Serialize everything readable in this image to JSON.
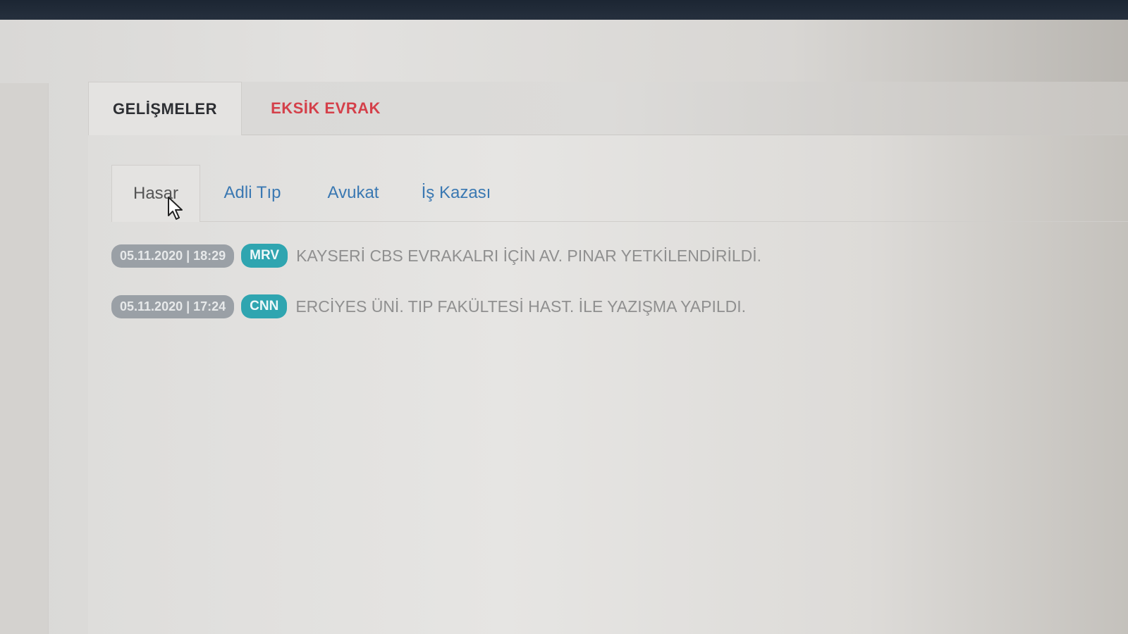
{
  "main_tabs": [
    {
      "label": "GELİŞMELER",
      "active": true
    },
    {
      "label": "EKSİK EVRAK",
      "active": false,
      "color": "#d4404a"
    }
  ],
  "sub_tabs": [
    {
      "label": "Hasar",
      "active": true
    },
    {
      "label": "Adli Tıp",
      "active": false
    },
    {
      "label": "Avukat",
      "active": false
    },
    {
      "label": "İş Kazası",
      "active": false
    }
  ],
  "entries": [
    {
      "datetime": "05.11.2020 | 18:29",
      "user": "MRV",
      "text": "KAYSERİ CBS EVRAKALRI İÇİN AV. PINAR YETKİLENDİRİLDİ."
    },
    {
      "datetime": "05.11.2020 | 17:24",
      "user": "CNN",
      "text": "ERCİYES ÜNİ. TIP FAKÜLTESİ HAST. İLE YAZIŞMA YAPILDI."
    }
  ],
  "colors": {
    "accent_link": "#3a78b2",
    "alert": "#d4404a",
    "date_badge": "#9aa0a6",
    "user_badge": "#2fa5b0"
  },
  "icons": {
    "cursor": "mouse-pointer-icon"
  }
}
